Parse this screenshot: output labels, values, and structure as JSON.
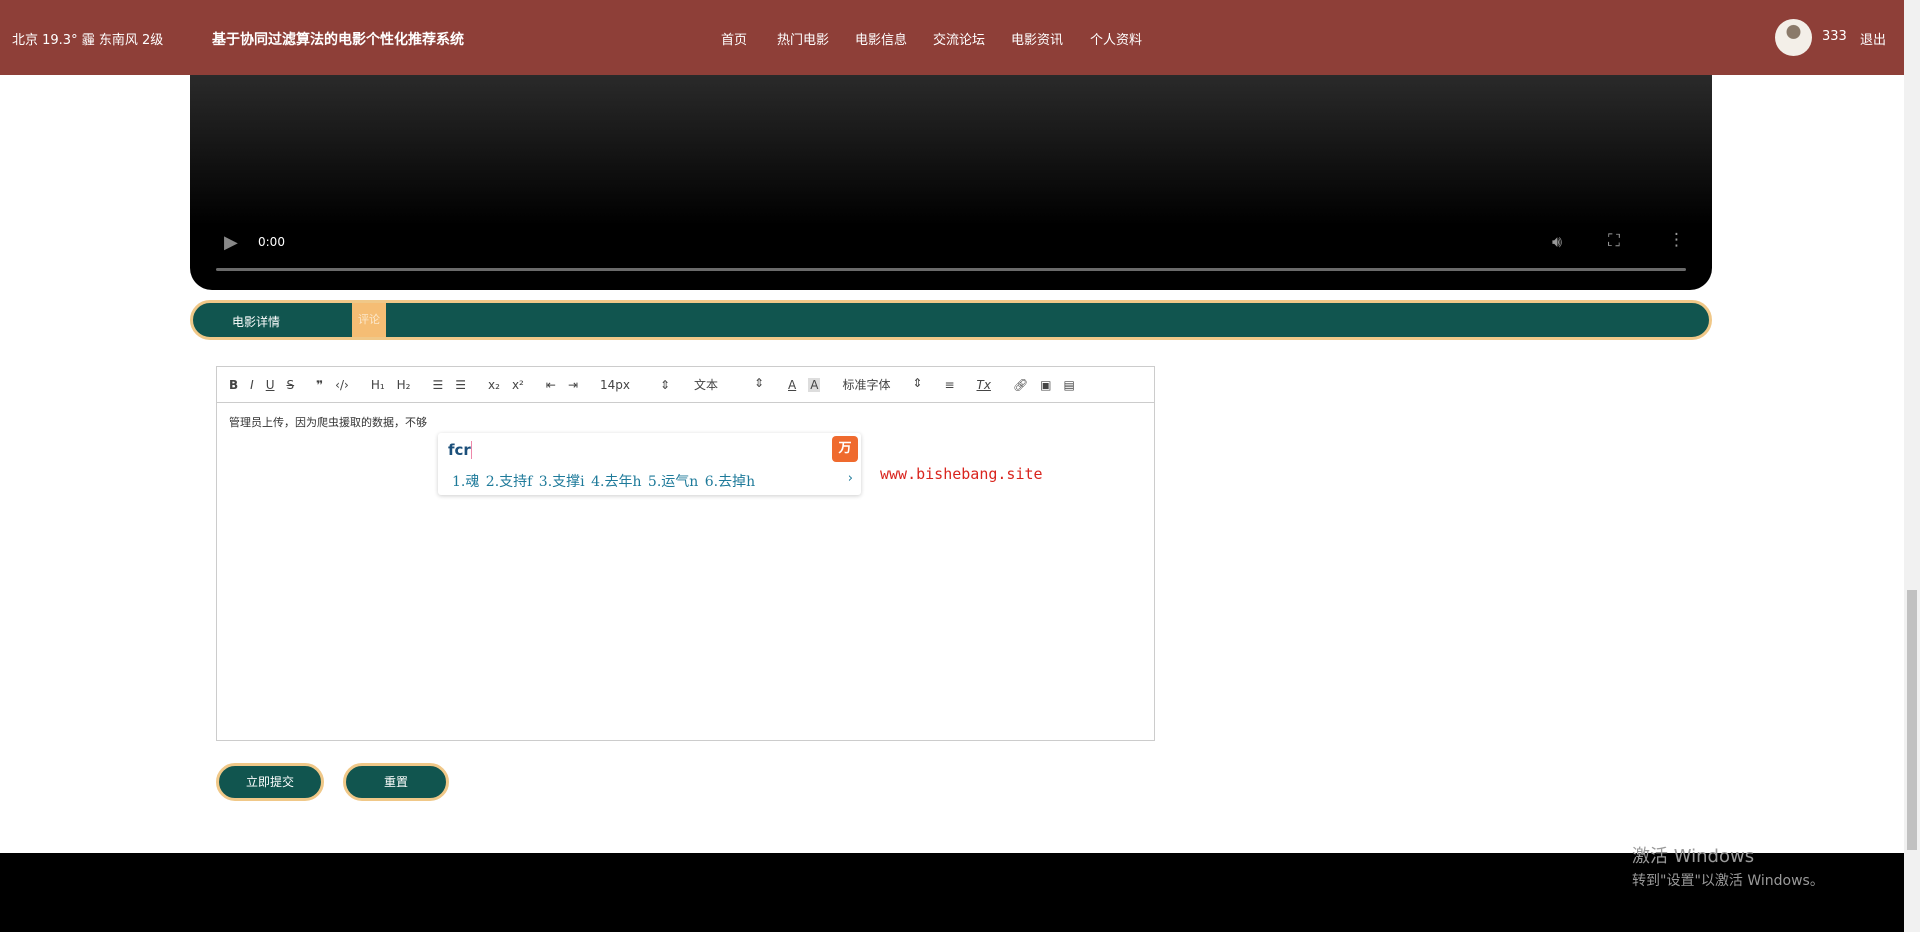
{
  "header": {
    "weather": "北京  19.3°  霾  东南风  2级",
    "title": "基于协同过滤算法的电影个性化推荐系统",
    "nav": [
      "首页",
      "热门电影",
      "电影信息",
      "交流论坛",
      "电影资讯",
      "个人资料"
    ],
    "username": "333",
    "logout": "退出"
  },
  "video": {
    "time": "0:00"
  },
  "tabs": [
    "电影详情",
    "评论"
  ],
  "editor": {
    "toolbar": {
      "size": "14px",
      "type": "文本",
      "font": "标准字体"
    },
    "content": "管理员上传，因为爬虫援取的数据，不够"
  },
  "ime": {
    "input": "fcr",
    "candidates": "1.魂 2.支持f 3.支撑i 4.去年h 5.运气n 6.去掉h"
  },
  "watermark_text": "www.bishebang.site",
  "buttons": {
    "submit": "立即提交",
    "reset": "重置"
  },
  "windows": {
    "line1": "激活 Windows",
    "line2": "转到\"设置\"以激活 Windows。"
  },
  "colors": {
    "header": "#8e3f38",
    "primary": "#11554f",
    "accent": "#f5bd74"
  }
}
